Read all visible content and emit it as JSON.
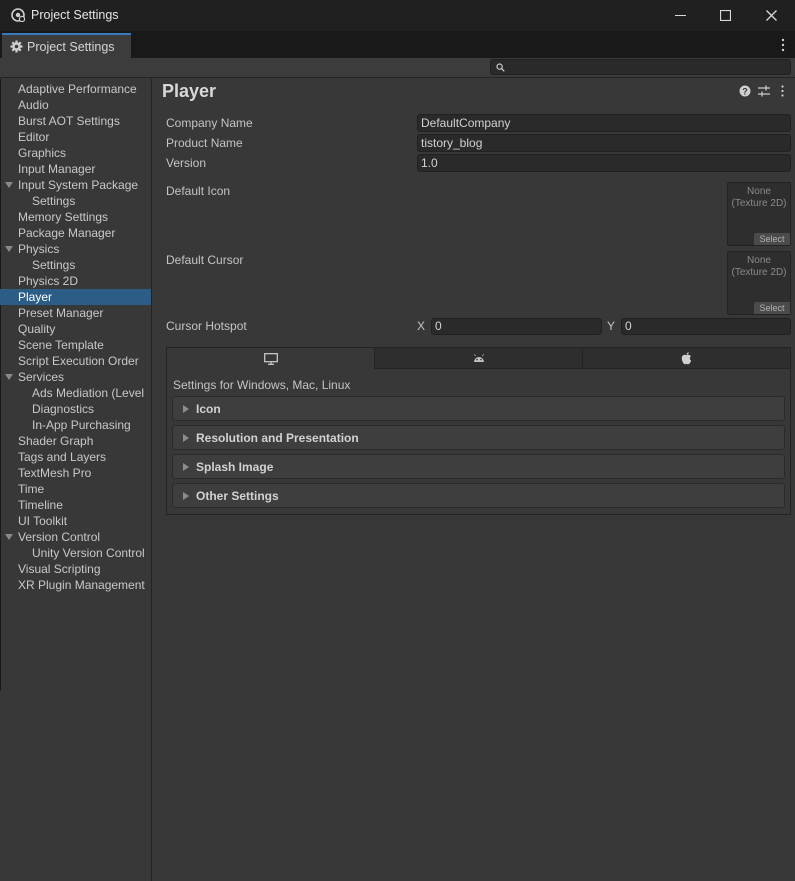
{
  "window": {
    "title": "Project Settings"
  },
  "tab": {
    "label": "Project Settings"
  },
  "search": {
    "placeholder": ""
  },
  "sidebar": {
    "items": [
      {
        "label": "Adaptive Performance",
        "indent": 0,
        "expanded": false,
        "selected": false
      },
      {
        "label": "Audio",
        "indent": 0,
        "selected": false
      },
      {
        "label": "Burst AOT Settings",
        "indent": 0,
        "selected": false
      },
      {
        "label": "Editor",
        "indent": 0,
        "selected": false
      },
      {
        "label": "Graphics",
        "indent": 0,
        "selected": false
      },
      {
        "label": "Input Manager",
        "indent": 0,
        "selected": false
      },
      {
        "label": "Input System Package",
        "indent": 0,
        "expanded": true,
        "selected": false
      },
      {
        "label": "Settings",
        "indent": 1,
        "selected": false
      },
      {
        "label": "Memory Settings",
        "indent": 0,
        "selected": false
      },
      {
        "label": "Package Manager",
        "indent": 0,
        "selected": false
      },
      {
        "label": "Physics",
        "indent": 0,
        "expanded": true,
        "selected": false
      },
      {
        "label": "Settings",
        "indent": 1,
        "selected": false
      },
      {
        "label": "Physics 2D",
        "indent": 0,
        "selected": false
      },
      {
        "label": "Player",
        "indent": 0,
        "selected": true
      },
      {
        "label": "Preset Manager",
        "indent": 0,
        "selected": false
      },
      {
        "label": "Quality",
        "indent": 0,
        "selected": false
      },
      {
        "label": "Scene Template",
        "indent": 0,
        "selected": false
      },
      {
        "label": "Script Execution Order",
        "indent": 0,
        "selected": false
      },
      {
        "label": "Services",
        "indent": 0,
        "expanded": true,
        "selected": false
      },
      {
        "label": "Ads Mediation (Level",
        "indent": 1,
        "selected": false
      },
      {
        "label": "Diagnostics",
        "indent": 1,
        "selected": false
      },
      {
        "label": "In-App Purchasing",
        "indent": 1,
        "selected": false
      },
      {
        "label": "Shader Graph",
        "indent": 0,
        "selected": false
      },
      {
        "label": "Tags and Layers",
        "indent": 0,
        "selected": false
      },
      {
        "label": "TextMesh Pro",
        "indent": 0,
        "selected": false
      },
      {
        "label": "Time",
        "indent": 0,
        "selected": false
      },
      {
        "label": "Timeline",
        "indent": 0,
        "selected": false
      },
      {
        "label": "UI Toolkit",
        "indent": 0,
        "selected": false
      },
      {
        "label": "Version Control",
        "indent": 0,
        "expanded": true,
        "selected": false
      },
      {
        "label": "Unity Version Control",
        "indent": 1,
        "selected": false
      },
      {
        "label": "Visual Scripting",
        "indent": 0,
        "selected": false
      },
      {
        "label": "XR Plugin Management",
        "indent": 0,
        "selected": false
      }
    ]
  },
  "player": {
    "title": "Player",
    "company_label": "Company Name",
    "company_value": "DefaultCompany",
    "product_label": "Product Name",
    "product_value": "tistory_blog",
    "version_label": "Version",
    "version_value": "1.0",
    "icon_label": "Default Icon",
    "cursor_label": "Default Cursor",
    "texture_none_line1": "None",
    "texture_none_line2": "(Texture 2D)",
    "select_label": "Select",
    "hotspot_label": "Cursor Hotspot",
    "x_label": "X",
    "x_value": "0",
    "y_label": "Y",
    "y_value": "0"
  },
  "platform": {
    "tabs": [
      "desktop-icon",
      "android-icon",
      "apple-icon"
    ],
    "active_tab": 0,
    "caption": "Settings for Windows, Mac, Linux",
    "sections": [
      "Icon",
      "Resolution and Presentation",
      "Splash Image",
      "Other Settings"
    ]
  },
  "colors": {
    "accent": "#2c5d87",
    "background": "#383838",
    "titlebar": "#202020"
  }
}
